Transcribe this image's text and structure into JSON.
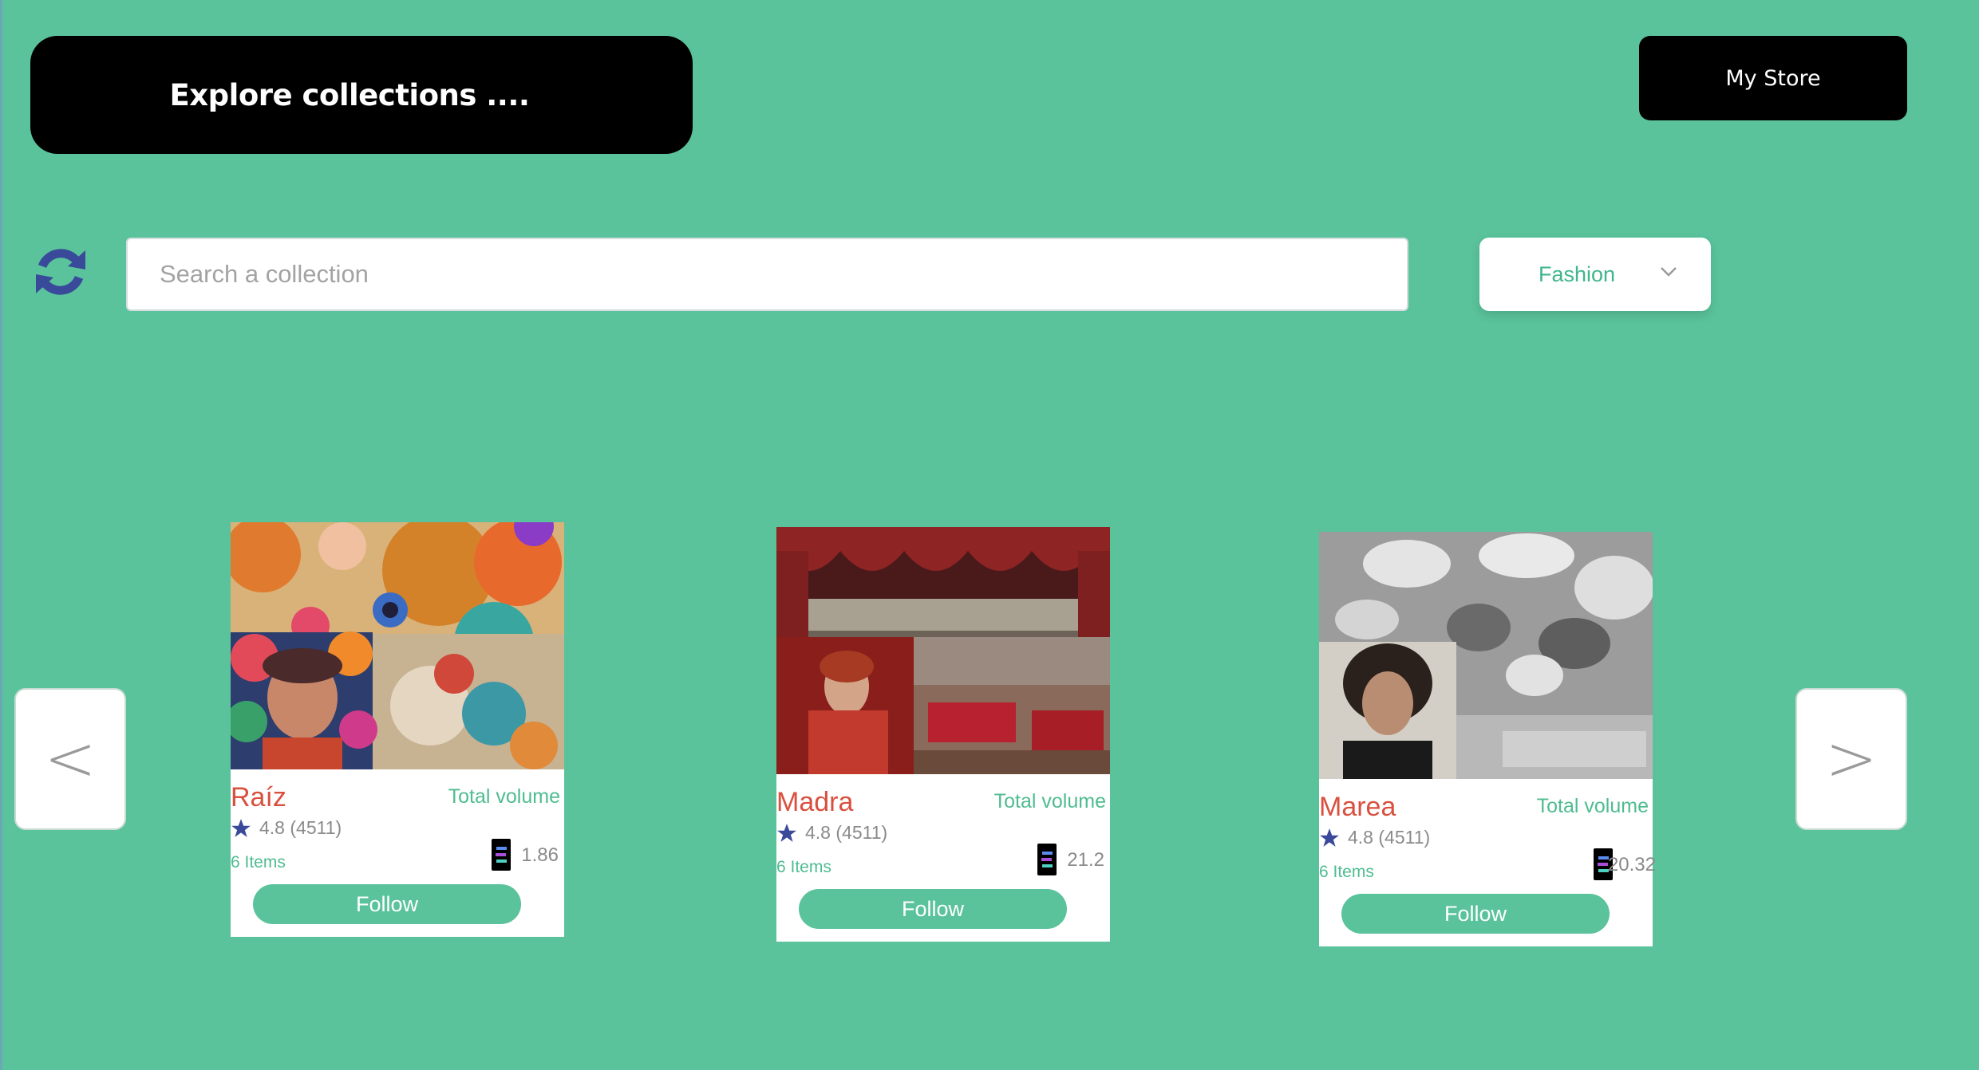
{
  "header": {
    "title": "Explore collections ....",
    "my_store_label": "My Store"
  },
  "search": {
    "placeholder": "Search a collection",
    "value": ""
  },
  "filter": {
    "selected": "Fashion"
  },
  "nav": {
    "prev_label": "<",
    "next_label": ">"
  },
  "cards": [
    {
      "name": "Raíz",
      "volume_label": "Total volume",
      "rating": "4.8 (4511)",
      "items": "6 Items",
      "volume": "1.86",
      "follow_label": "Follow"
    },
    {
      "name": "Madra",
      "volume_label": "Total volume",
      "rating": "4.8 (4511)",
      "items": "6 Items",
      "volume": "21.2",
      "follow_label": "Follow"
    },
    {
      "name": "Marea",
      "volume_label": "Total volume",
      "rating": "4.8 (4511)",
      "items": "6 Items",
      "volume": "20.32",
      "follow_label": "Follow"
    }
  ],
  "colors": {
    "background": "#5ac39b",
    "accent_green": "#4fbc90",
    "title_red": "#d9503f",
    "star_blue": "#3a4a9a",
    "refresh_blue": "#3a4a9a"
  },
  "icons": {
    "refresh": "refresh-icon",
    "chevron": "chevron-down-icon",
    "star": "star-icon",
    "token": "token-icon"
  }
}
